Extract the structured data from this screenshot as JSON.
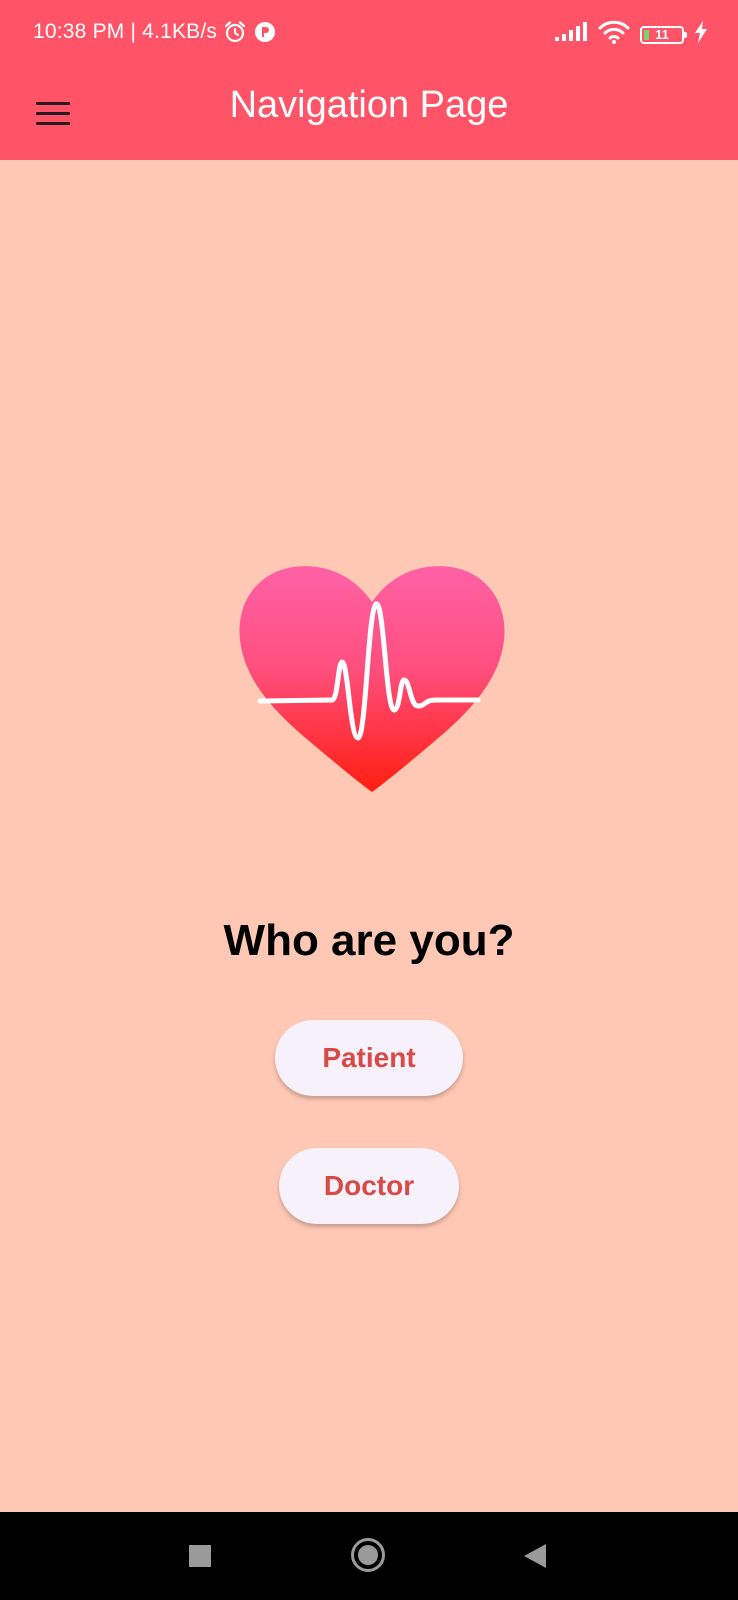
{
  "status_bar": {
    "time": "10:38 PM",
    "separator": "|",
    "network_speed": "4.1KB/s",
    "battery_level": "11",
    "icons": [
      "alarm-icon",
      "app-notification-icon",
      "signal-icon",
      "wifi-icon",
      "battery-icon",
      "charging-icon"
    ]
  },
  "app_bar": {
    "title": "Navigation Page",
    "menu_icon": "hamburger-menu-icon",
    "background_color": "#FF5468"
  },
  "main": {
    "logo_icon": "heart-pulse-icon",
    "question": "Who are you?",
    "buttons": {
      "patient": "Patient",
      "doctor": "Doctor"
    },
    "background_color": "#FFC8B4",
    "button_text_color": "#D84A45"
  },
  "nav_bar": {
    "icons": [
      "recents-icon",
      "home-icon",
      "back-icon"
    ]
  }
}
